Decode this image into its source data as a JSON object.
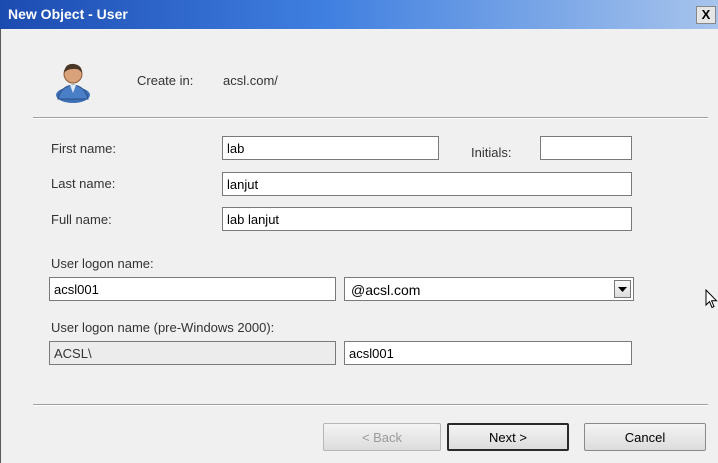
{
  "window": {
    "title": "New Object - User",
    "close_label": "X"
  },
  "create_in": {
    "label": "Create in:",
    "value": "acsl.com/"
  },
  "first_name": {
    "label": "First name:",
    "value": "lab"
  },
  "initials": {
    "label": "Initials:",
    "value": ""
  },
  "last_name": {
    "label": "Last name:",
    "value": "lanjut"
  },
  "full_name": {
    "label": "Full name:",
    "value": "lab lanjut"
  },
  "logon_name": {
    "label": "User logon name:",
    "value": "acsl001",
    "domain": "@acsl.com"
  },
  "pre2000": {
    "label": "User logon name (pre-Windows 2000):",
    "domain": "ACSL\\",
    "value": "acsl001"
  },
  "buttons": {
    "back": "< Back",
    "next": "Next >",
    "cancel": "Cancel"
  },
  "icons": {
    "user": "user-icon",
    "combo": "chevron-down-icon",
    "cursor": "cursor-arrow-icon"
  }
}
